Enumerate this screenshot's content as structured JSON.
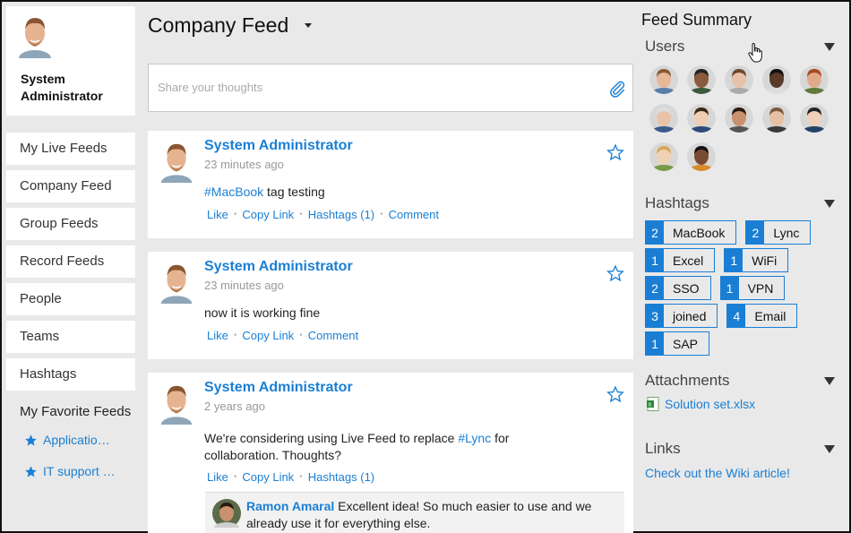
{
  "profile": {
    "name": "System Administrator"
  },
  "nav": [
    "My Live Feeds",
    "Company Feed",
    "Group Feeds",
    "Record Feeds",
    "People",
    "Teams",
    "Hashtags"
  ],
  "favorites": {
    "title": "My Favorite Feeds",
    "items": [
      "Applicatio…",
      "IT support …"
    ]
  },
  "main": {
    "title": "Company Feed",
    "share_placeholder": "Share your thoughts"
  },
  "posts": [
    {
      "author": "System Administrator",
      "time": "23 minutes ago",
      "hashtag": "#MacBook",
      "text": " tag testing",
      "actions": [
        "Like",
        "Copy Link",
        "Hashtags (1)",
        "Comment"
      ]
    },
    {
      "author": "System Administrator",
      "time": "23 minutes ago",
      "text": "now it is working fine",
      "actions": [
        "Like",
        "Copy Link",
        "Comment"
      ]
    },
    {
      "author": "System Administrator",
      "time": "2 years ago",
      "text_before": "We're considering using Live Feed to replace ",
      "hashtag": "#Lync",
      "text_after": " for collaboration. Thoughts?",
      "actions": [
        "Like",
        "Copy Link",
        "Hashtags (1)"
      ],
      "reply": {
        "author": "Ramon Amaral",
        "text": " Excellent idea! So much easier to use and we already use it for everything else."
      }
    }
  ],
  "summary": {
    "title": "Feed Summary",
    "users_label": "Users",
    "users": [
      {
        "skin": "#e8b79a",
        "hair": "#8a5a33",
        "shirt": "#5a7ea8"
      },
      {
        "skin": "#8a5a3c",
        "hair": "#222",
        "shirt": "#3b5a3b"
      },
      {
        "skin": "#e7c2a8",
        "hair": "#6b4a2f",
        "shirt": "#aaaaaa"
      },
      {
        "skin": "#5a3a28",
        "hair": "#111",
        "shirt": "#dddddd"
      },
      {
        "skin": "#e1a98b",
        "hair": "#a84a22",
        "shirt": "#5f7a3a"
      },
      {
        "skin": "#e8c3a8",
        "hair": "#ddd",
        "shirt": "#3a5a8a"
      },
      {
        "skin": "#f0cdb0",
        "hair": "#3a2a1a",
        "shirt": "#2e4a7a"
      },
      {
        "skin": "#c9926e",
        "hair": "#2a1a10",
        "shirt": "#555"
      },
      {
        "skin": "#e6c1a3",
        "hair": "#7a5a3a",
        "shirt": "#3a3a3a"
      },
      {
        "skin": "#f0d0b8",
        "hair": "#222",
        "shirt": "#224466"
      },
      {
        "skin": "#efd2b6",
        "hair": "#d9a75a",
        "shirt": "#7a9a4a"
      },
      {
        "skin": "#7a4a30",
        "hair": "#111",
        "shirt": "#d98a2a"
      }
    ],
    "hashtags_label": "Hashtags",
    "hashtags": [
      {
        "count": "2",
        "name": "MacBook"
      },
      {
        "count": "2",
        "name": "Lync"
      },
      {
        "count": "1",
        "name": "Excel"
      },
      {
        "count": "1",
        "name": "WiFi"
      },
      {
        "count": "2",
        "name": "SSO"
      },
      {
        "count": "1",
        "name": "VPN"
      },
      {
        "count": "3",
        "name": "joined"
      },
      {
        "count": "4",
        "name": "Email"
      },
      {
        "count": "1",
        "name": "SAP"
      }
    ],
    "attachments_label": "Attachments",
    "attachment": "Solution set.xlsx",
    "links_label": "Links",
    "link": "Check out the Wiki article!"
  },
  "colors": {
    "accent": "#1a7fd4",
    "background": "#e9e9e9"
  }
}
